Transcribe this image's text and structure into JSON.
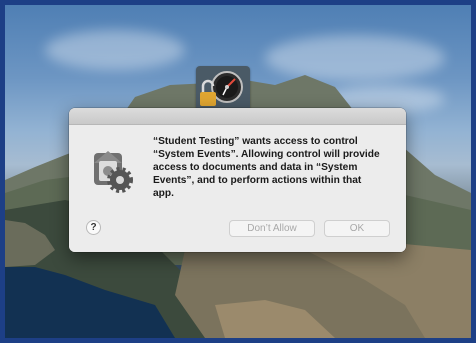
{
  "desktop": {
    "wallpaper": "coastal island landscape"
  },
  "dock": {
    "icon_name": "lock-clock-icon"
  },
  "dialog": {
    "message": "“Student Testing” wants access to control “System Events”. Allowing control will provide access to documents and data in “System Events”, and to perform actions within that app.",
    "help_label": "?",
    "deny_label": "Don’t Allow",
    "ok_label": "OK",
    "icon_name": "automation-gear-icon"
  },
  "colors": {
    "frame": "#1d3f86",
    "dialog_bg": "#ececec",
    "text": "#1a1a1a",
    "button_disabled_text": "#a8a8a8"
  }
}
